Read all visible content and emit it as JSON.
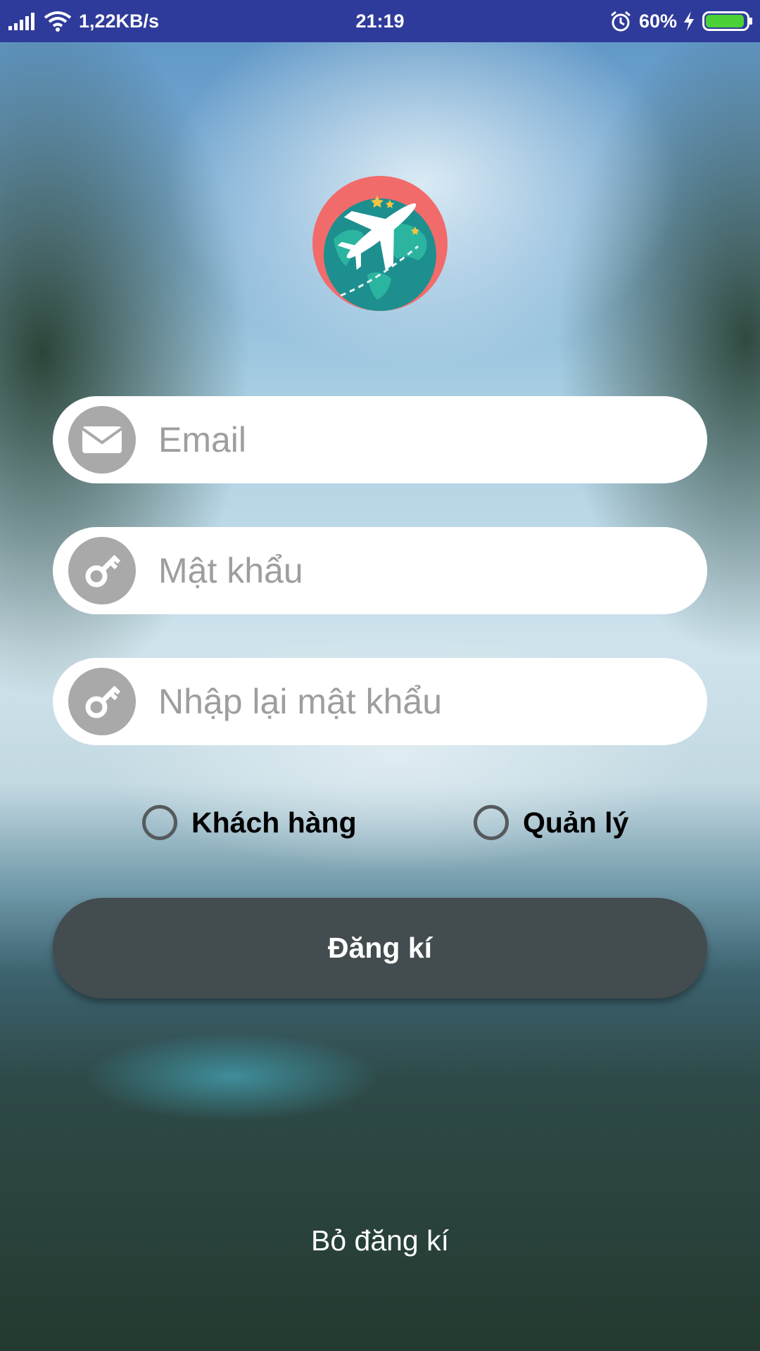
{
  "status_bar": {
    "network_speed": "1,22KB/s",
    "time": "21:19",
    "battery_percent": "60%",
    "battery_level": 0.6,
    "icons": [
      "signal-icon",
      "wifi-icon",
      "alarm-icon",
      "charging-icon",
      "battery-icon"
    ]
  },
  "logo": {
    "icon": "globe-airplane-logo",
    "colors": {
      "circle": "#f26b6b",
      "globe": "#1e8f8f",
      "land": "#2bb5a0",
      "plane": "#ffffff",
      "stars": "#f5c542"
    }
  },
  "form": {
    "email_placeholder": "Email",
    "password_placeholder": "Mật khẩu",
    "confirm_password_placeholder": "Nhập lại mật khẩu",
    "email_icon": "envelope-icon",
    "password_icon": "key-icon"
  },
  "roles": {
    "customer_label": "Khách hàng",
    "manager_label": "Quản lý"
  },
  "actions": {
    "register_label": "Đăng kí",
    "cancel_label": "Bỏ đăng kí"
  },
  "colors": {
    "status_bar": "#2f3b9a",
    "button": "#434c4e",
    "icon_circle": "#a9a9a9",
    "placeholder": "#9e9e9e"
  }
}
